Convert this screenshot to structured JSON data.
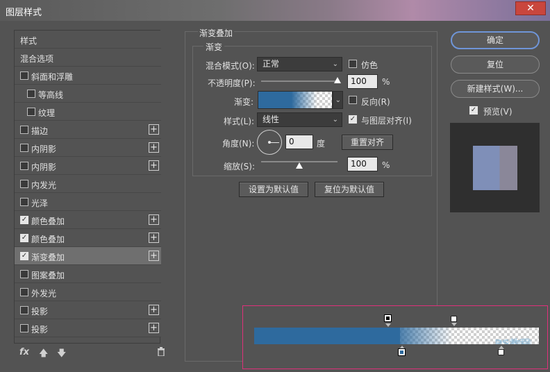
{
  "window": {
    "title": "图层样式",
    "close_label": "✕"
  },
  "style_list": [
    {
      "label": "样式",
      "checkbox": false,
      "checked": false,
      "plus": false,
      "selected": false,
      "indent": 0
    },
    {
      "label": "混合选项",
      "checkbox": false,
      "checked": false,
      "plus": false,
      "selected": false,
      "indent": 0
    },
    {
      "label": "斜面和浮雕",
      "checkbox": true,
      "checked": false,
      "plus": false,
      "selected": false,
      "indent": 0
    },
    {
      "label": "等高线",
      "checkbox": true,
      "checked": false,
      "plus": false,
      "selected": false,
      "indent": 1
    },
    {
      "label": "纹理",
      "checkbox": true,
      "checked": false,
      "plus": false,
      "selected": false,
      "indent": 1
    },
    {
      "label": "描边",
      "checkbox": true,
      "checked": false,
      "plus": true,
      "selected": false,
      "indent": 0
    },
    {
      "label": "内阴影",
      "checkbox": true,
      "checked": false,
      "plus": true,
      "selected": false,
      "indent": 0
    },
    {
      "label": "内阴影",
      "checkbox": true,
      "checked": false,
      "plus": true,
      "selected": false,
      "indent": 0
    },
    {
      "label": "内发光",
      "checkbox": true,
      "checked": false,
      "plus": false,
      "selected": false,
      "indent": 0
    },
    {
      "label": "光泽",
      "checkbox": true,
      "checked": false,
      "plus": false,
      "selected": false,
      "indent": 0
    },
    {
      "label": "颜色叠加",
      "checkbox": true,
      "checked": true,
      "plus": true,
      "selected": false,
      "indent": 0
    },
    {
      "label": "颜色叠加",
      "checkbox": true,
      "checked": true,
      "plus": true,
      "selected": false,
      "indent": 0
    },
    {
      "label": "渐变叠加",
      "checkbox": true,
      "checked": true,
      "plus": true,
      "selected": true,
      "indent": 0
    },
    {
      "label": "图案叠加",
      "checkbox": true,
      "checked": false,
      "plus": false,
      "selected": false,
      "indent": 0
    },
    {
      "label": "外发光",
      "checkbox": true,
      "checked": false,
      "plus": false,
      "selected": false,
      "indent": 0
    },
    {
      "label": "投影",
      "checkbox": true,
      "checked": false,
      "plus": true,
      "selected": false,
      "indent": 0
    },
    {
      "label": "投影",
      "checkbox": true,
      "checked": false,
      "plus": true,
      "selected": false,
      "indent": 0
    }
  ],
  "bottom_icons": {
    "fx": "fx",
    "up": "up-arrow-icon",
    "down": "down-arrow-icon",
    "trash": "trash-icon"
  },
  "panel": {
    "group_title": "渐变叠加",
    "sub_title": "渐变",
    "blend_mode_label": "混合模式(O):",
    "blend_mode_value": "正常",
    "dither_label": "仿色",
    "dither_checked": false,
    "opacity_label": "不透明度(P):",
    "opacity_value": "100",
    "opacity_unit": "%",
    "opacity_level": 1.0,
    "gradient_label": "渐变:",
    "reverse_label": "反向(R)",
    "reverse_checked": false,
    "style_label": "样式(L):",
    "style_value": "线性",
    "align_label": "与图层对齐(I)",
    "align_checked": true,
    "angle_label": "角度(N):",
    "angle_value": "0",
    "angle_unit": "度",
    "reset_align_label": "重置对齐",
    "scale_label": "缩放(S):",
    "scale_value": "100",
    "scale_unit": "%",
    "scale_level": 0.5,
    "set_default_label": "设置为默认值",
    "reset_default_label": "复位为默认值"
  },
  "actions": {
    "ok_label": "确定",
    "reset_label": "复位",
    "new_style_label": "新建样式(W)...",
    "preview_label": "预览(V)",
    "preview_checked": true
  },
  "gradient_editor": {
    "watermark_main": "PS教程",
    "watermark_sub": "优化教程网"
  },
  "colors": {
    "gradient_blue": "#2e6a9e",
    "accent": "#6f95d8",
    "highlight_border": "#e0307a",
    "preview_left": "#7f8fb8",
    "preview_right": "#8a8799"
  }
}
